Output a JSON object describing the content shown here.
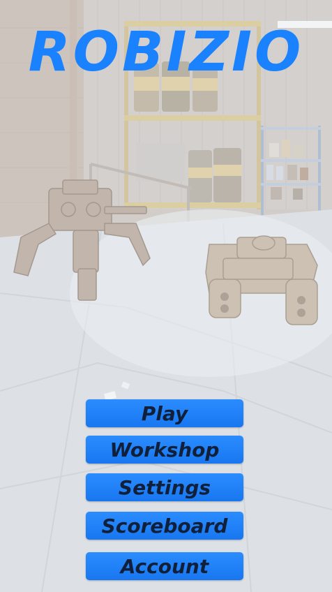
{
  "game": {
    "title": "ROBIZIO",
    "title_color": "#1a82ff"
  },
  "menu": {
    "button_color": "#1e80ff",
    "items": [
      {
        "label": "Play"
      },
      {
        "label": "Workshop"
      },
      {
        "label": "Settings"
      },
      {
        "label": "Scoreboard"
      },
      {
        "label": "Account"
      }
    ]
  }
}
